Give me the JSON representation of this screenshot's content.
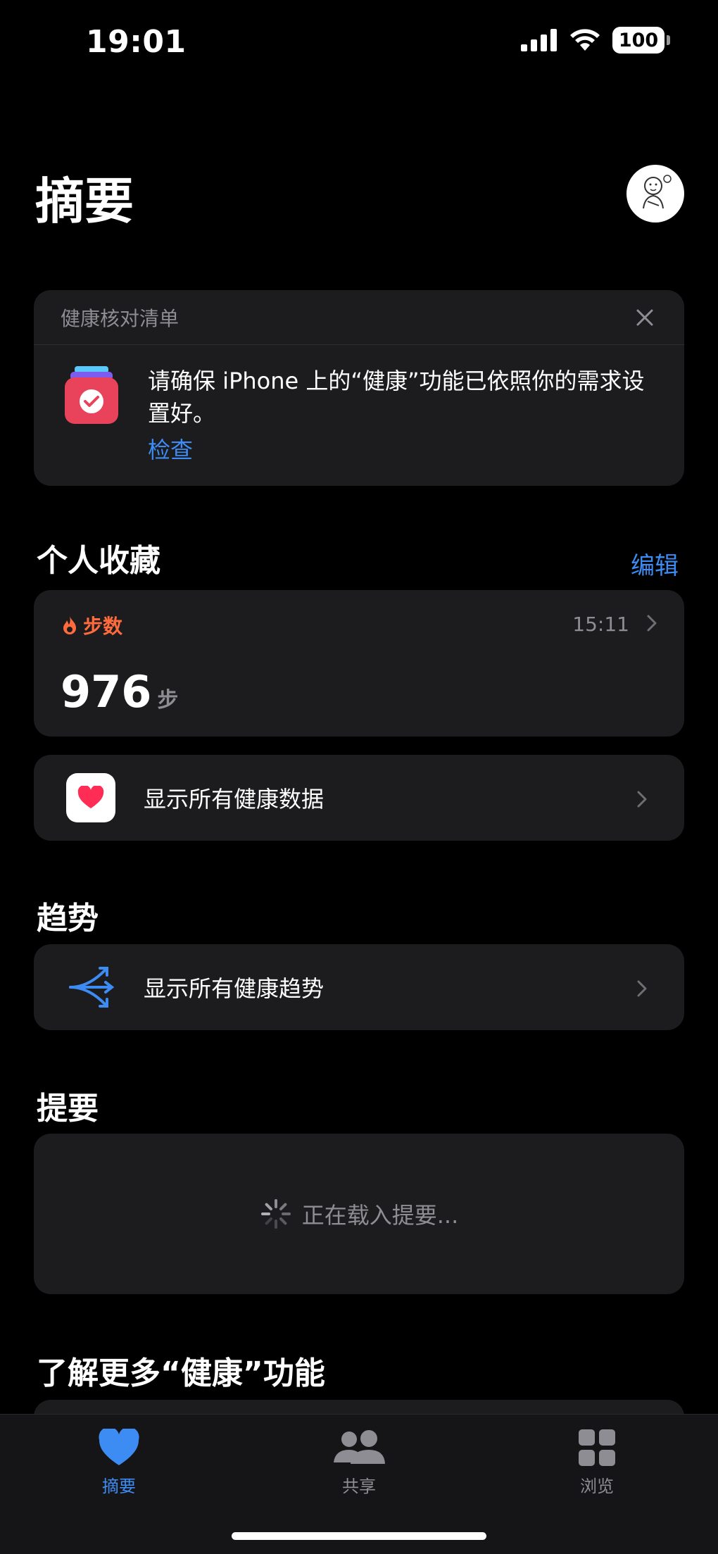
{
  "status_bar": {
    "time": "19:01",
    "battery": "100"
  },
  "header": {
    "title": "摘要"
  },
  "checklist": {
    "title": "健康核对清单",
    "message": "请确保 iPhone 上的“健康”功能已依照你的需求设置好。",
    "action": "检查"
  },
  "favorites": {
    "title": "个人收藏",
    "edit": "编辑",
    "steps": {
      "label": "步数",
      "time": "15:11",
      "value": "976",
      "unit": "步"
    },
    "show_all": "显示所有健康数据"
  },
  "trends": {
    "title": "趋势",
    "show_all": "显示所有健康趋势"
  },
  "highlights": {
    "title": "提要",
    "loading": "正在载入提要..."
  },
  "learn_more": {
    "title": "了解更多“健康”功能"
  },
  "tabbar": {
    "tabs": [
      {
        "label": "摘要",
        "active": true
      },
      {
        "label": "共享",
        "active": false
      },
      {
        "label": "浏览",
        "active": false
      }
    ]
  },
  "colors": {
    "accent": "#3c8cf4",
    "steps": "#ff6b3d",
    "heart": "#ff2d55"
  }
}
